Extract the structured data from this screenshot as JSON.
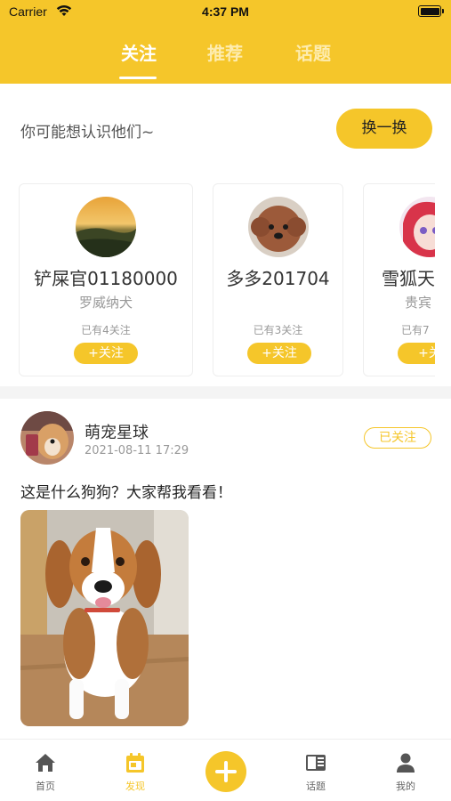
{
  "status_bar": {
    "carrier": "Carrier",
    "time": "4:37 PM"
  },
  "tabs": [
    {
      "label": "关注",
      "active": true
    },
    {
      "label": "推荐",
      "active": false
    },
    {
      "label": "话题",
      "active": false
    }
  ],
  "suggest": {
    "title": "你可能想认识他们~",
    "swap_label": "换一换",
    "cards": [
      {
        "name": "铲屎官01180000",
        "breed": "罗威纳犬",
        "count": "已有4关注",
        "follow_label": "+关注"
      },
      {
        "name": "多多201704",
        "breed": "",
        "count": "已有3关注",
        "follow_label": "+关注"
      },
      {
        "name": "雪狐天",
        "breed": "贵宾",
        "count": "已有7",
        "follow_label": "+关"
      }
    ]
  },
  "post": {
    "author": "萌宠星球",
    "time": "2021-08-11 17:29",
    "follow_status": "已关注",
    "text": "这是什么狗狗？大家帮我看看！"
  },
  "bottom_nav": [
    {
      "label": "首页",
      "icon": "home-icon",
      "active": false
    },
    {
      "label": "发现",
      "icon": "calendar-icon",
      "active": true
    },
    {
      "label": "",
      "icon": "plus-icon",
      "active": false
    },
    {
      "label": "话题",
      "icon": "topic-icon",
      "active": false
    },
    {
      "label": "我的",
      "icon": "user-icon",
      "active": false
    }
  ],
  "colors": {
    "accent": "#F5C62A",
    "muted": "#999999",
    "text": "#333333"
  }
}
